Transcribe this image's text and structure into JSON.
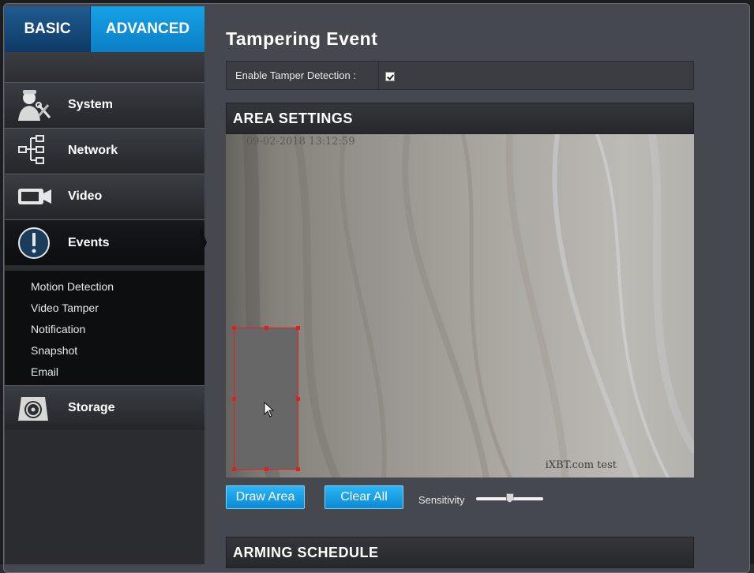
{
  "mode_tabs": {
    "basic": "BASIC",
    "advanced": "ADVANCED"
  },
  "sidebar": {
    "items": [
      {
        "label": "System",
        "icon": "system-admin-icon"
      },
      {
        "label": "Network",
        "icon": "network-tree-icon"
      },
      {
        "label": "Video",
        "icon": "video-camera-icon"
      },
      {
        "label": "Events",
        "icon": "alert-exclamation-icon",
        "active": true
      },
      {
        "label": "Storage",
        "icon": "storage-disk-icon"
      }
    ],
    "events_submenu": [
      "Motion Detection",
      "Video Tamper",
      "Notification",
      "Snapshot",
      "Email"
    ]
  },
  "page": {
    "title": "Tampering Event",
    "enable_label": "Enable Tamper Detection :",
    "enable_checked": true,
    "area_settings_title": "AREA SETTINGS",
    "arming_schedule_title": "ARMING SCHEDULE"
  },
  "video": {
    "timestamp": "09-02-2018  13:12:59",
    "watermark": "iXBT.com test"
  },
  "controls": {
    "draw_area": "Draw Area",
    "clear_all": "Clear All",
    "sensitivity_label": "Sensitivity",
    "sensitivity_fraction": 0.5
  },
  "colors": {
    "accent": "#16a2e6",
    "area_border": "#e0201c"
  }
}
